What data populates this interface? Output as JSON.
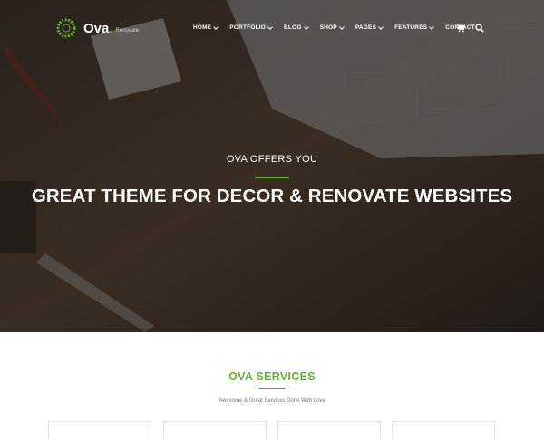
{
  "brand": {
    "name": "Ova",
    "dot": ".",
    "tagline": "Renovate",
    "accent_color": "#62b32f"
  },
  "nav": {
    "items": [
      {
        "label": "HOME",
        "has_dropdown": true
      },
      {
        "label": "PORTFOLIO",
        "has_dropdown": true
      },
      {
        "label": "BLOG",
        "has_dropdown": true
      },
      {
        "label": "SHOP",
        "has_dropdown": true
      },
      {
        "label": "PAGES",
        "has_dropdown": true
      },
      {
        "label": "FEATURES",
        "has_dropdown": true
      },
      {
        "label": "CONTACT",
        "has_dropdown": false
      }
    ],
    "icons": [
      "cart-icon",
      "search-icon"
    ]
  },
  "hero": {
    "subtitle": "OVA OFFERS YOU",
    "title": "GREAT THEME FOR DECOR & RENOVATE WEBSITES"
  },
  "services": {
    "title": "OVA SERVICES",
    "subtitle": "Awesome & Great Services Done With Love"
  }
}
